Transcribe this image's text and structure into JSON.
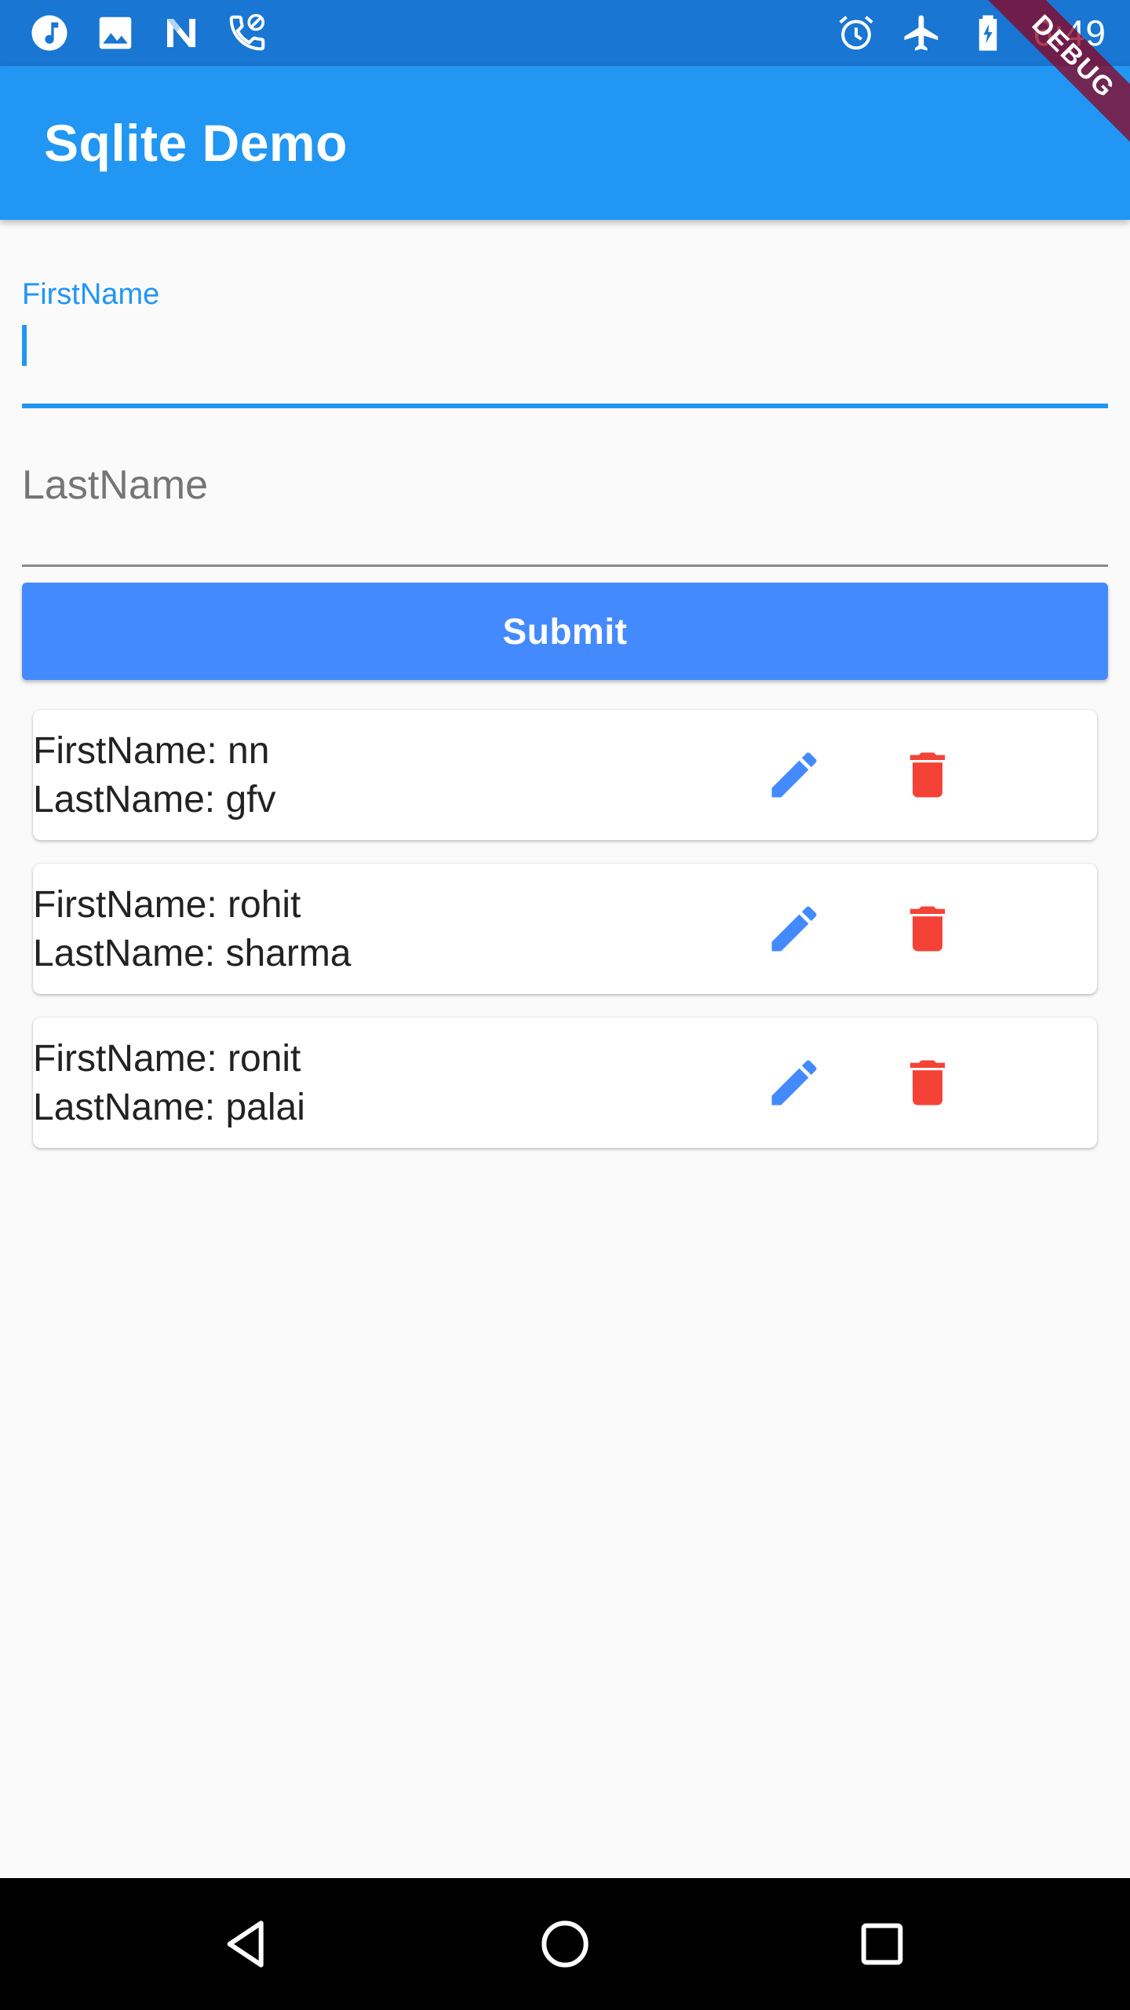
{
  "status_bar": {
    "time": "6:49",
    "left_icons": [
      "music-note-icon",
      "image-icon",
      "n-logo-icon",
      "phone-blocked-icon"
    ],
    "right_icons": [
      "alarm-icon",
      "airplane-icon",
      "battery-charging-icon"
    ]
  },
  "debug_banner": "DEBUG",
  "app_bar": {
    "title": "Sqlite Demo"
  },
  "form": {
    "first_name": {
      "label": "FirstName",
      "value": ""
    },
    "last_name": {
      "placeholder": "LastName",
      "value": ""
    },
    "submit_label": "Submit"
  },
  "records": [
    {
      "first": "FirstName: nn",
      "last": "LastName: gfv"
    },
    {
      "first": "FirstName: rohit",
      "last": "LastName: sharma"
    },
    {
      "first": "FirstName: ronit",
      "last": "LastName: palai"
    }
  ],
  "colors": {
    "status_bar": "#1976d2",
    "app_bar": "#2196f3",
    "accent": "#448aff",
    "edit_icon": "#448aff",
    "delete_icon": "#f44336"
  },
  "nav_bar": {
    "icons": [
      "back-icon",
      "home-icon",
      "recents-icon"
    ]
  }
}
